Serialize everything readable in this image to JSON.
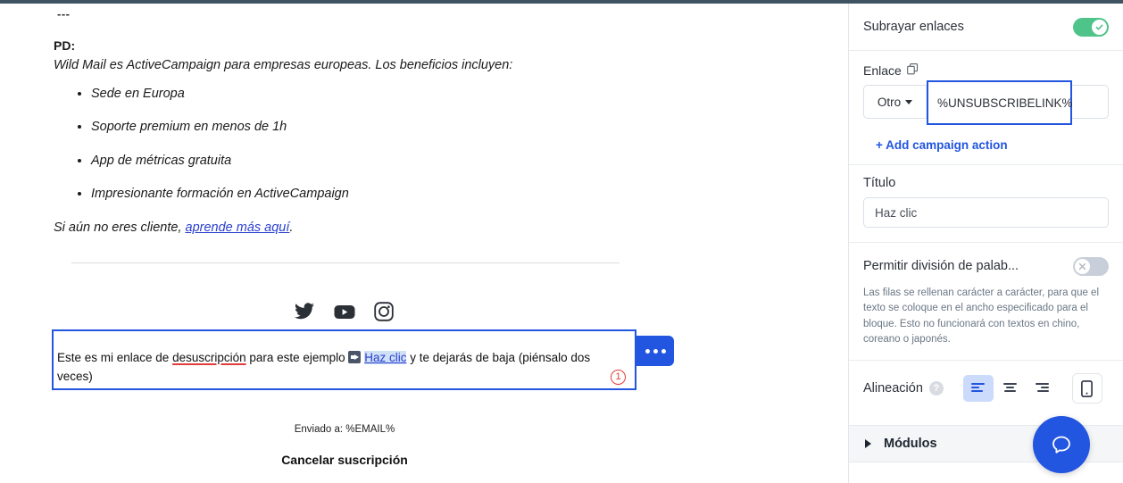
{
  "email": {
    "dashes": "---",
    "pd_label": "PD:",
    "intro": "Wild Mail es ActiveCampaign para empresas europeas. Los beneficios incluyen:",
    "benefits": [
      "Sede en Europa",
      "Soporte premium en menos de 1h",
      "App de métricas gratuita",
      "Impresionante formación en ActiveCampaign"
    ],
    "closing_prefix": "Si aún no eres cliente, ",
    "closing_link": "aprende más aquí",
    "closing_suffix": ".",
    "social_icons": [
      "twitter-icon",
      "youtube-icon",
      "instagram-icon"
    ],
    "selected_block": {
      "text_before": "Este es mi enlace de ",
      "misspelled": "desuscripción",
      "text_middle": " para este ejemplo ",
      "link_text": "Haz clic",
      "text_after": " y te dejarás de baja (piénsalo dos veces)",
      "badge": "1"
    },
    "more_options_label": "•••",
    "footer_sent": "Enviado a: %EMAIL%",
    "footer_unsubscribe": "Cancelar suscripción"
  },
  "panel": {
    "underline_links": {
      "label": "Subrayar enlaces",
      "state": "on"
    },
    "link": {
      "label": "Enlace",
      "copy_icon": "copy-icon",
      "select_value": "Otro",
      "value": "%UNSUBSCRIBELINK%",
      "add_action_label": "+ Add campaign action"
    },
    "title": {
      "label": "Título",
      "value": "Haz clic"
    },
    "hyphenation": {
      "label": "Permitir división de palab...",
      "state": "off",
      "helper": "Las filas se rellenan carácter a carácter, para que el texto se coloque en el ancho especificado para el bloque. Esto no funcionará con textos en chino, coreano o japonés."
    },
    "alignment": {
      "label": "Alineación",
      "help": "?",
      "options": [
        "align-left",
        "align-center",
        "align-right"
      ],
      "selected": "align-left",
      "mobile_button": "mobile-preview-icon"
    },
    "modules": {
      "label": "Módulos"
    },
    "chat": {
      "icon": "chat-bubble-icon"
    }
  },
  "colors": {
    "accent_blue": "#2255e0",
    "toggle_on_green": "#4fc48a",
    "toggle_off_gray": "#c9cfda",
    "spell_error_red": "#e23b3b",
    "top_strip": "#3f5463"
  }
}
